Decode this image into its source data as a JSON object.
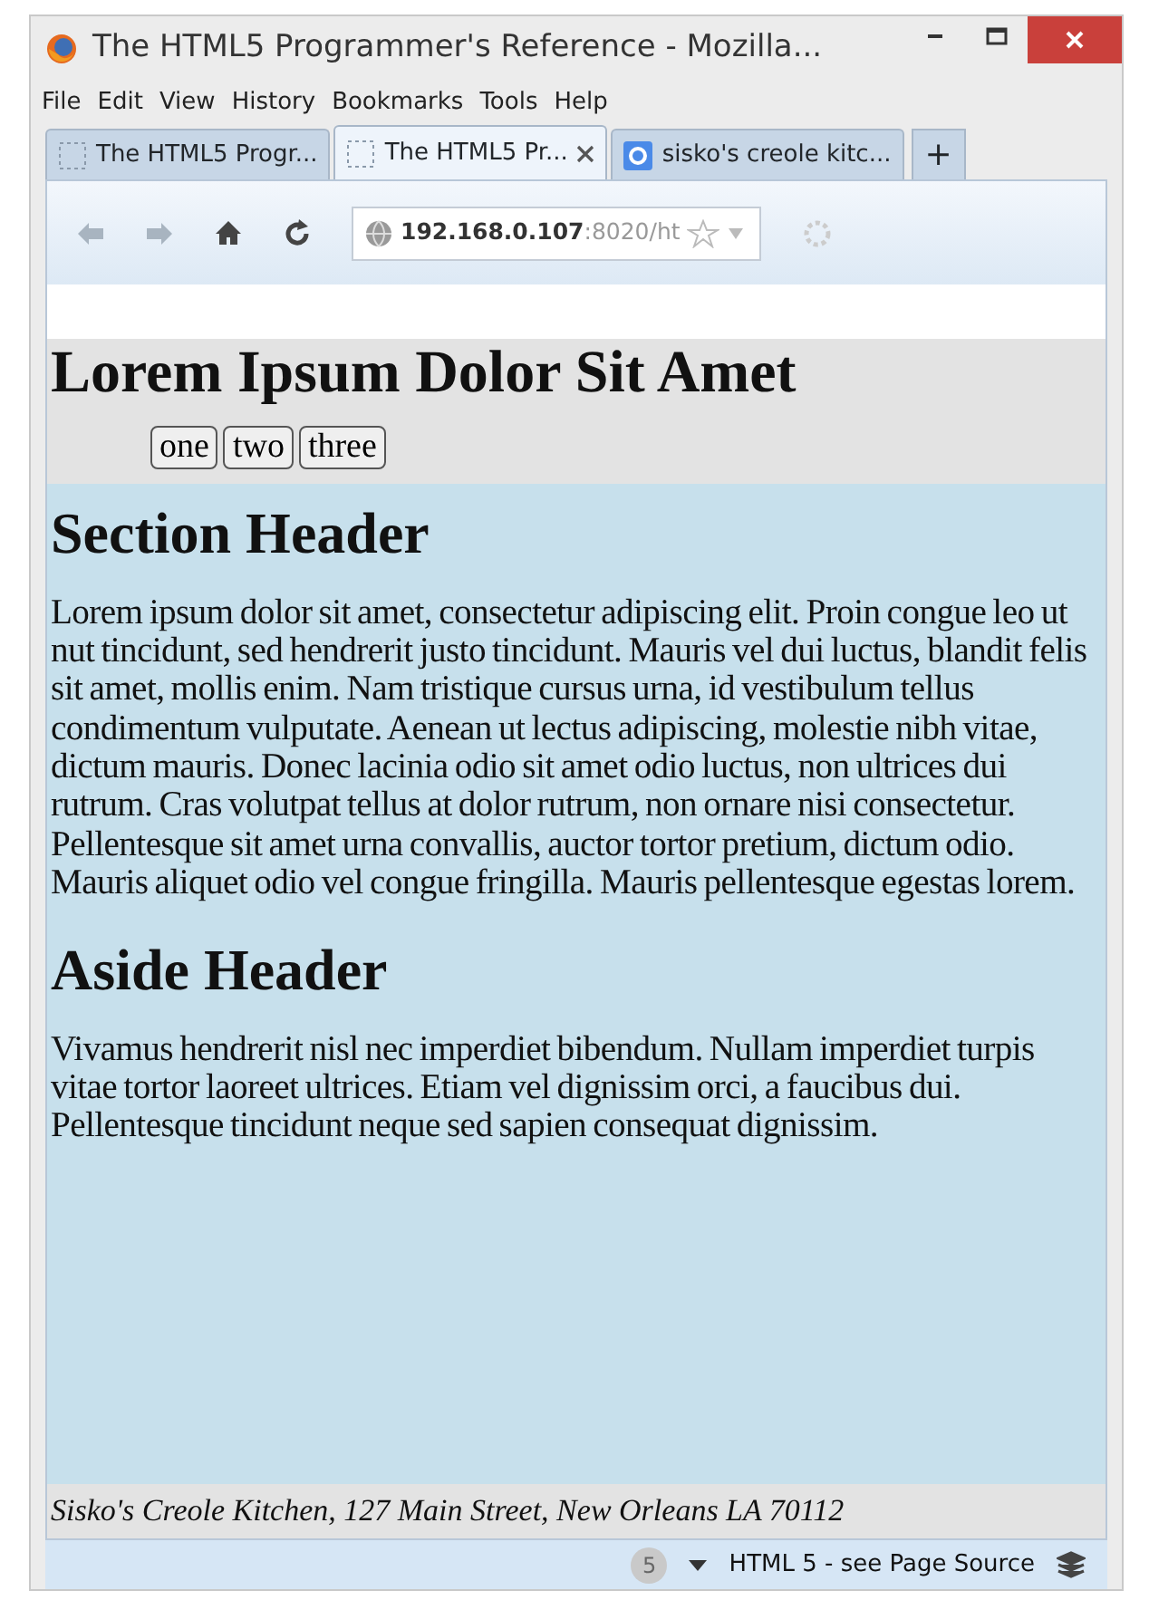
{
  "window": {
    "title": "The HTML5 Programmer's Reference - Mozilla..."
  },
  "menu": [
    {
      "label": "File"
    },
    {
      "label": "Edit"
    },
    {
      "label": "View"
    },
    {
      "label": "History"
    },
    {
      "label": "Bookmarks"
    },
    {
      "label": "Tools"
    },
    {
      "label": "Help"
    }
  ],
  "tabs": [
    {
      "label": "The HTML5 Progr...",
      "selected": false,
      "kind": "blank"
    },
    {
      "label": "The HTML5 Pr...",
      "selected": true,
      "kind": "blank"
    },
    {
      "label": "sisko's creole kitc...",
      "selected": false,
      "kind": "search"
    }
  ],
  "new_tab": "+",
  "address": {
    "host": "192.168.0.107",
    "rest": ":8020/ht"
  },
  "page": {
    "title": "Lorem Ipsum Dolor Sit Amet",
    "buttons": [
      "one",
      "two",
      "three"
    ],
    "sections": [
      {
        "heading": "Section Header",
        "text": "Lorem ipsum dolor sit amet, consectetur adipiscing elit. Proin congue leo ut nut tincidunt, sed hendrerit justo tincidunt. Mauris vel dui luctus, blandit felis sit amet, mollis enim. Nam tristique cursus urna, id vestibulum tellus condimentum vulputate. Aenean ut lectus adipiscing, molestie nibh vitae, dictum mauris. Donec lacinia odio sit amet odio luctus, non ultrices dui rutrum. Cras volutpat tellus at dolor rutrum, non ornare nisi consectetur. Pellentesque sit amet urna convallis, auctor tortor pretium, dictum odio. Mauris aliquet odio vel congue fringilla. Mauris pellentesque egestas lorem."
      },
      {
        "heading": "Aside Header",
        "text": "Vivamus hendrerit nisl nec imperdiet bibendum. Nullam imperdiet turpis vitae tortor laoreet ultrices. Etiam vel dignissim orci, a faucibus dui. Pellentesque tincidunt neque sed sapien consequat dignissim."
      }
    ],
    "footer": "Sisko's Creole Kitchen, 127 Main Street, New Orleans LA 70112"
  },
  "status_bar": {
    "badge": "5",
    "text": "HTML 5 - see Page Source"
  }
}
